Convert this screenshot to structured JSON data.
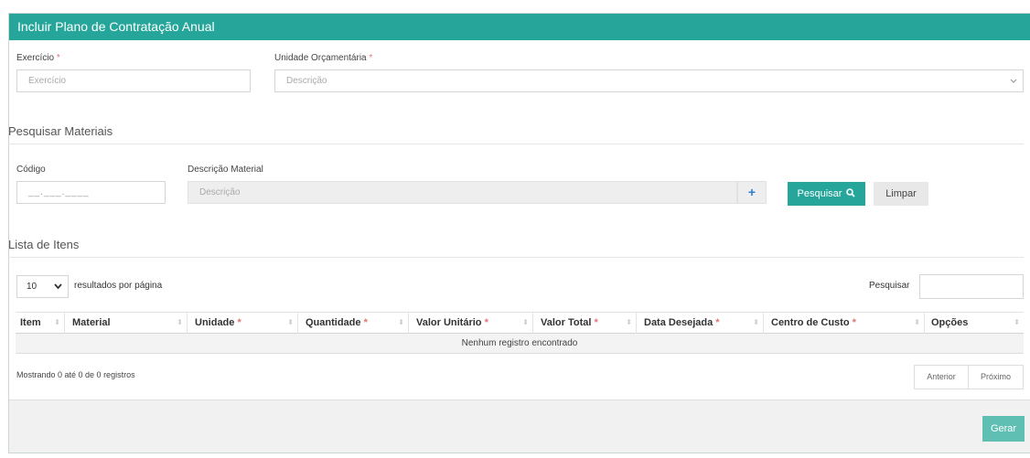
{
  "title": "Incluir Plano de Contratação Anual",
  "exercicio": {
    "label": "Exercício",
    "placeholder": "Exercício"
  },
  "unidade": {
    "label": "Unidade Orçamentária",
    "placeholder": "Descrição"
  },
  "required_mark": "*",
  "pesquisar_materiais": {
    "title": "Pesquisar Materiais",
    "codigo_label": "Código",
    "codigo_mask": "__.___.____",
    "descricao_label": "Descrição Material",
    "descricao_placeholder": "Descrição",
    "plus": "+",
    "search_button": "Pesquisar",
    "clear_button": "Limpar"
  },
  "lista": {
    "title": "Lista de Itens",
    "page_size": "10",
    "per_page_label": "resultados por página",
    "search_label": "Pesquisar",
    "columns": [
      {
        "label": "Item",
        "required": false
      },
      {
        "label": "Material",
        "required": false
      },
      {
        "label": "Unidade",
        "required": true
      },
      {
        "label": "Quantidade",
        "required": true
      },
      {
        "label": "Valor Unitário",
        "required": true
      },
      {
        "label": "Valor Total",
        "required": true
      },
      {
        "label": "Data Desejada",
        "required": true
      },
      {
        "label": "Centro de Custo",
        "required": true
      },
      {
        "label": "Opções",
        "required": false
      }
    ],
    "empty": "Nenhum registro encontrado",
    "info": "Mostrando 0 até 0 de 0 registros",
    "prev": "Anterior",
    "next": "Próximo"
  },
  "gerar": "Gerar",
  "colors": {
    "accent": "#26a69a",
    "required": "#e57373"
  }
}
